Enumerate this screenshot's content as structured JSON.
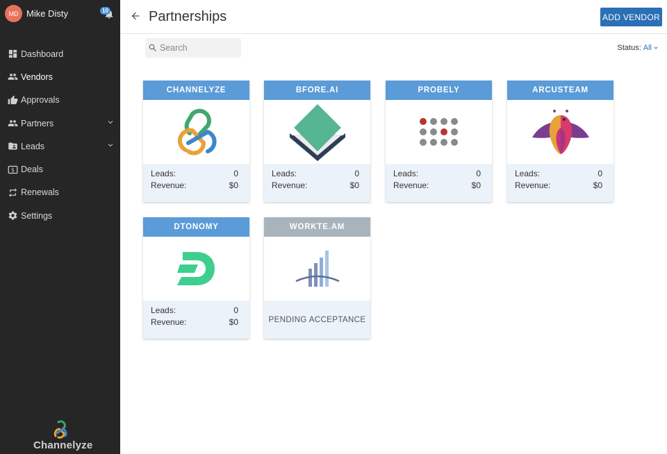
{
  "user": {
    "initials": "MD",
    "name": "Mike Disty",
    "notifications": "10"
  },
  "nav": [
    {
      "label": "Dashboard",
      "icon": "dashboard-icon"
    },
    {
      "label": "Vendors",
      "icon": "people-icon",
      "active": true
    },
    {
      "label": "Approvals",
      "icon": "thumbs-up-icon"
    },
    {
      "label": "Partners",
      "icon": "people-icon",
      "expandable": true
    },
    {
      "label": "Leads",
      "icon": "folder-icon",
      "expandable": true
    },
    {
      "label": "Deals",
      "icon": "dollar-icon"
    },
    {
      "label": "Renewals",
      "icon": "repeat-icon"
    },
    {
      "label": "Settings",
      "icon": "gear-icon"
    }
  ],
  "brand": "Channelyze",
  "header": {
    "title": "Partnerships",
    "add_button": "ADD VENDOR"
  },
  "search": {
    "placeholder": "Search"
  },
  "status": {
    "label": "Status:",
    "value": "All"
  },
  "cards": [
    {
      "name": "CHANNELYZE",
      "leads_label": "Leads:",
      "leads": "0",
      "revenue_label": "Revenue:",
      "revenue": "$0"
    },
    {
      "name": "BFORE.AI",
      "leads_label": "Leads:",
      "leads": "0",
      "revenue_label": "Revenue:",
      "revenue": "$0"
    },
    {
      "name": "PROBELY",
      "leads_label": "Leads:",
      "leads": "0",
      "revenue_label": "Revenue:",
      "revenue": "$0"
    },
    {
      "name": "ARCUSTEAM",
      "leads_label": "Leads:",
      "leads": "0",
      "revenue_label": "Revenue:",
      "revenue": "$0"
    },
    {
      "name": "DTONOMY",
      "leads_label": "Leads:",
      "leads": "0",
      "revenue_label": "Revenue:",
      "revenue": "$0"
    },
    {
      "name": "WORKTE.AM",
      "status": "PENDING ACCEPTANCE"
    }
  ],
  "colors": {
    "sidebar": "#262626",
    "accent": "#2b6fb6",
    "card_header": "#5a9bd8",
    "pending_header": "#a9b3bb",
    "card_footer": "#ebf2f9"
  }
}
